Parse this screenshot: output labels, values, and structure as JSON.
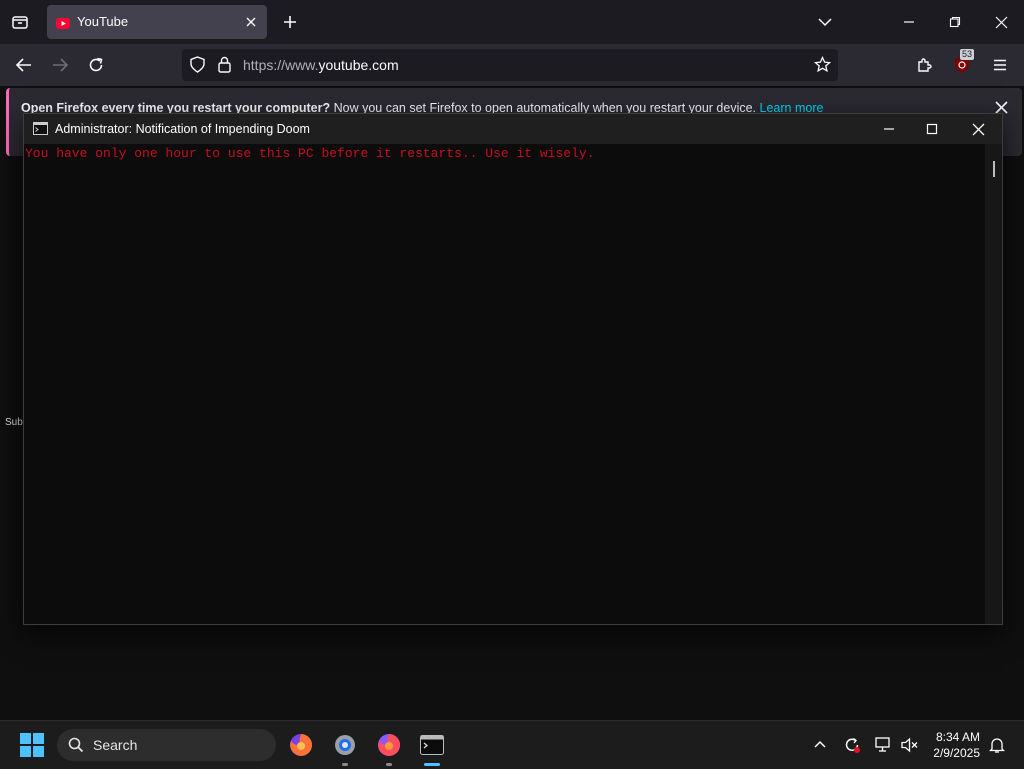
{
  "browser": {
    "tab": {
      "title": "YouTube"
    },
    "url": {
      "prefix": "https://www.",
      "domain": "youtube.com"
    },
    "extension_badge": "53",
    "notification": {
      "bold_text": "Open Firefox every time you restart your computer?",
      "text": " Now you can set Firefox to open automatically when you restart your device.",
      "link": "Learn more"
    }
  },
  "youtube_bg": {
    "sidebar_fragment": "Subs"
  },
  "console": {
    "title": "Administrator:  Notification of Impending Doom",
    "output_line": "You have only one hour to use this PC before it restarts.. Use it wisely."
  },
  "taskbar": {
    "search_label": "Search",
    "time": "8:34 AM",
    "date": "2/9/2025"
  },
  "colors": {
    "console_text": "#c50f1f",
    "browser_bg": "#1c1b22",
    "accent_link": "#00ddff"
  }
}
